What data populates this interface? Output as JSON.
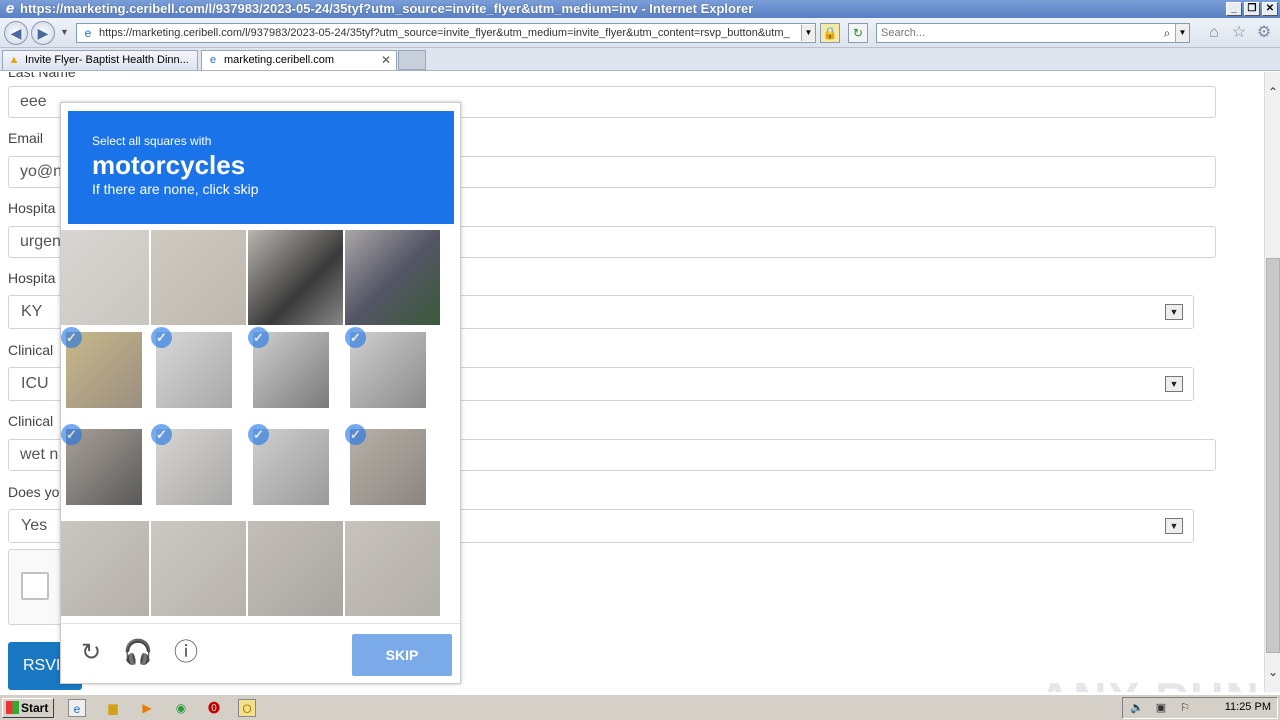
{
  "window": {
    "title": "https://marketing.ceribell.com/l/937983/2023-05-24/35tyf?utm_source=invite_flyer&utm_medium=inv - Internet Explorer",
    "minimize": "_",
    "restore": "❐",
    "close": "✕"
  },
  "nav": {
    "back": "◀",
    "forward": "▶",
    "address": "https://marketing.ceribell.com/l/937983/2023-05-24/35tyf?utm_source=invite_flyer&utm_medium=invite_flyer&utm_content=rsvp_button&utm_",
    "lock": "🔒",
    "refresh": "↻",
    "search_placeholder": "Search..."
  },
  "tabs": [
    {
      "label": "Invite Flyer- Baptist Health Dinn...",
      "icon": "drive-icon"
    },
    {
      "label": "marketing.ceribell.com",
      "icon": "ie-icon"
    }
  ],
  "form": {
    "last_name_label": "Last Name",
    "last_name_value": "eee",
    "email_label": "Email",
    "email_value": "yo@n",
    "hospital_label": "Hospita",
    "hospital_value": "urgen",
    "hospital_state_label": "Hospita",
    "hospital_state_value": "KY",
    "clinical_label_1": "Clinical",
    "clinical_value_1": "ICU",
    "clinical_label_2": "Clinical",
    "clinical_value_2": "wet n",
    "does_label": "Does yo",
    "does_value": "Yes",
    "rsvp_label": "RSVI"
  },
  "captcha": {
    "instruction_top": "Select all squares with",
    "target_word": "motorcycles",
    "instruction_bottom": "If there are none, click skip",
    "skip_label": "SKIP",
    "selected_tiles": [
      4,
      5,
      6,
      7,
      8,
      9,
      10,
      11
    ],
    "tile_count": 16
  },
  "watermark": "ANY RUN",
  "taskbar": {
    "start_label": "Start",
    "clock": "11:25 PM"
  }
}
